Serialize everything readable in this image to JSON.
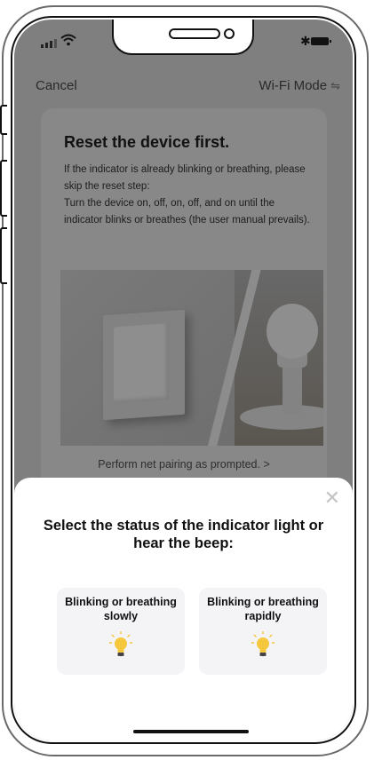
{
  "header": {
    "cancel_label": "Cancel",
    "mode_label": "Wi-Fi Mode",
    "mode_icon": "swap-arrows-icon"
  },
  "card": {
    "title": "Reset the device first.",
    "lines": [
      "If the indicator is already blinking or breathing, please skip the reset step:",
      "Turn the device on, off, on, off, and on until the indicator blinks or breathes (the user manual prevails)."
    ],
    "link_label": "Perform net pairing as prompted. >"
  },
  "sheet": {
    "title": "Select the status of the indicator light or hear the beep:",
    "options": [
      {
        "label": "Blinking or breathing slowly",
        "icon": "lightbulb-icon"
      },
      {
        "label": "Blinking or breathing rapidly",
        "icon": "lightbulb-icon"
      }
    ],
    "close_icon": "close-icon"
  },
  "colors": {
    "overlay": "#7f7f7f",
    "sheet": "#ffffff",
    "option_bg": "#f4f4f7",
    "bulb": "#f5c73d"
  }
}
